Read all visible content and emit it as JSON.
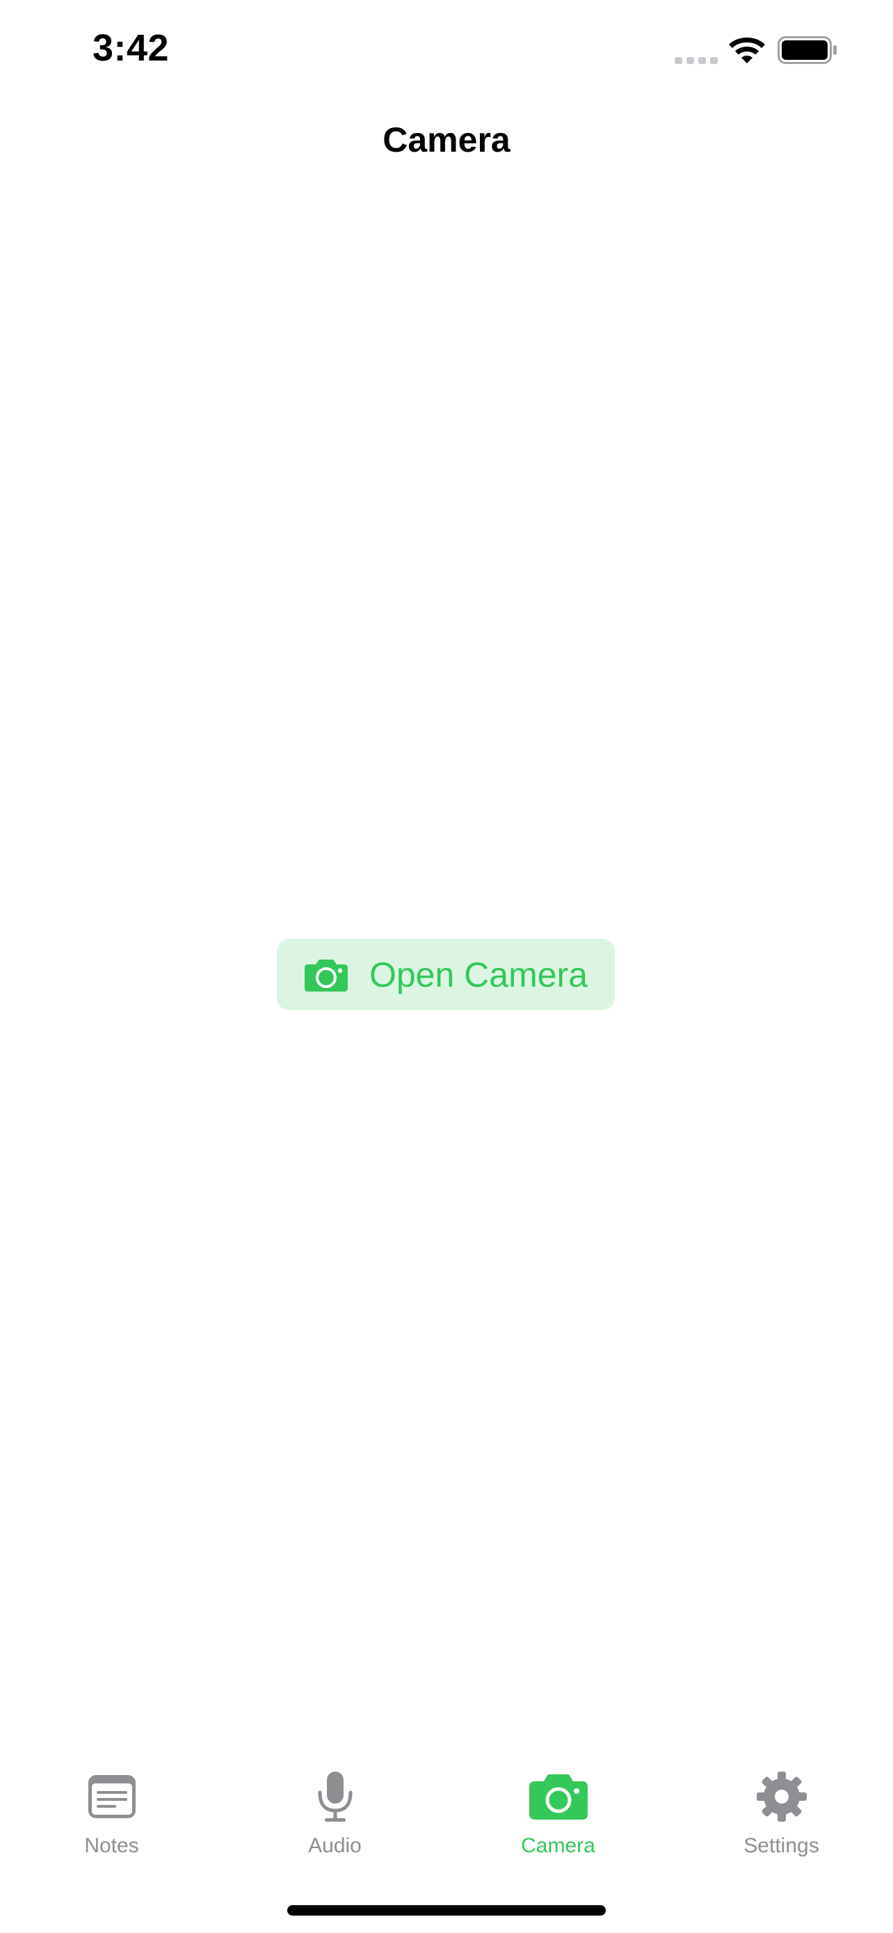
{
  "status_bar": {
    "time": "3:42",
    "signal_icon": "cellular-signal-icon",
    "wifi_icon": "wifi-icon",
    "battery_icon": "battery-full-icon"
  },
  "nav": {
    "title": "Camera"
  },
  "main": {
    "open_camera_button": {
      "label": "Open Camera",
      "icon": "camera-icon"
    }
  },
  "tab_bar": {
    "items": [
      {
        "label": "Notes",
        "icon": "notes-icon",
        "active": false
      },
      {
        "label": "Audio",
        "icon": "microphone-icon",
        "active": false
      },
      {
        "label": "Camera",
        "icon": "camera-icon",
        "active": true
      },
      {
        "label": "Settings",
        "icon": "gear-icon",
        "active": false
      }
    ]
  },
  "colors": {
    "accent": "#34c759",
    "accent_background": "#dcf5e3",
    "inactive": "#8e8e93",
    "background": "#ffffff",
    "text": "#000000"
  }
}
